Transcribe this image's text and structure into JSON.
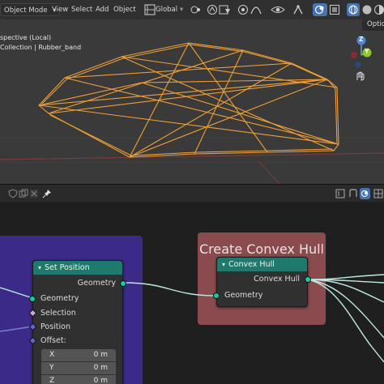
{
  "viewport": {
    "header": {
      "object_mode": "Object Mode",
      "menu": [
        "View",
        "Select",
        "Add",
        "Object"
      ],
      "orientation": "Global",
      "options_label": "Option"
    },
    "overlay": {
      "view_name": "spective (Local)",
      "collection": "Collection | Rubber_band"
    },
    "gizmo": {
      "y_label": "Y",
      "z_label": "Z"
    },
    "wire_color": "#f0a030"
  },
  "node_editor": {
    "frame_title": "Create Convex Hull",
    "set_position": {
      "title": "Set Position",
      "output_geometry": "Geometry",
      "input_geometry": "Geometry",
      "selection": "Selection",
      "position": "Position",
      "offset": "Offset:",
      "offset_fields": [
        {
          "axis": "X",
          "value": "0 m"
        },
        {
          "axis": "Y",
          "value": "0 m"
        },
        {
          "axis": "Z",
          "value": "0 m"
        }
      ]
    },
    "convex_hull": {
      "title": "Convex Hull",
      "output": "Convex Hull",
      "input": "Geometry"
    },
    "colors": {
      "frame_purple": "#3b2a87",
      "frame_red": "#8a4b4e",
      "node_header": "#1e7a6c",
      "geometry_socket": "#00d6a3",
      "link": "#bfe9e0"
    }
  }
}
